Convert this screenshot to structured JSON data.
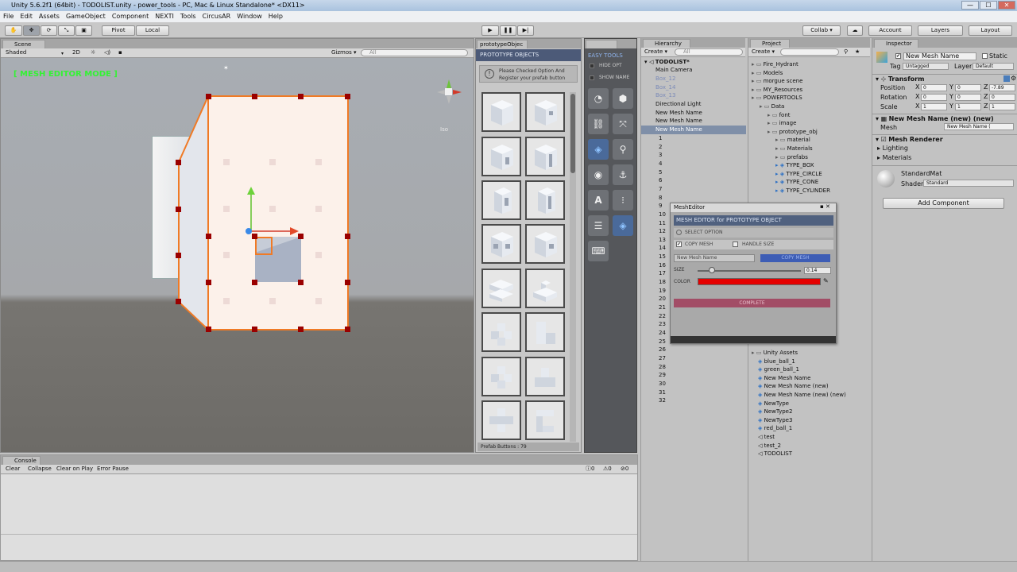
{
  "window": {
    "title": "Unity 5.6.2f1 (64bit) - TODOLIST.unity - power_tools - PC, Mac & Linux Standalone* <DX11>",
    "min": "—",
    "max": "☐",
    "close": "✕"
  },
  "menu": [
    "File",
    "Edit",
    "Assets",
    "GameObject",
    "Component",
    "NEXTI",
    "Tools",
    "CircusAR",
    "Window",
    "Help"
  ],
  "toolbar": {
    "pivot": "Pivot",
    "local": "Local",
    "collab": "Collab ▾",
    "account": "Account",
    "layers": "Layers",
    "layout": "Layout"
  },
  "scene": {
    "tab": "Scene",
    "shaded": "Shaded",
    "two_d": "2D",
    "gizmos": "Gizmos ▾",
    "search": "All",
    "mode": "[ MESH EDITOR MODE ]",
    "iso": "Iso"
  },
  "proto": {
    "tab": "prototypeObjec",
    "header": "PROTOTYPE OBJECTS",
    "info_line1": "Please Checked Option And",
    "info_line2": "Register your prefab button",
    "footer": "Prefab Buttons : 79"
  },
  "easy": {
    "header": "EASY TOOLS",
    "hide": "HIDE OPT",
    "show": "SHOW NAME"
  },
  "hierarchy": {
    "tab": "Hierarchy",
    "create": "Create ▾",
    "search": "All",
    "scene_name": "TODOLIST*",
    "items": [
      "Main Camera",
      "Box_12",
      "Box_14",
      "Box_13",
      "Directional Light",
      "New Mesh Name",
      "New Mesh Name",
      "New Mesh Name"
    ],
    "numbers": [
      "1",
      "2",
      "3",
      "4",
      "5",
      "6",
      "7",
      "8",
      "9",
      "10",
      "11",
      "12",
      "13",
      "14",
      "15",
      "16",
      "17",
      "18",
      "19",
      "20",
      "21",
      "22",
      "23",
      "24",
      "25",
      "26",
      "27",
      "28",
      "29",
      "30",
      "31",
      "32"
    ]
  },
  "project": {
    "tab": "Project",
    "create": "Create ▾",
    "tree": [
      "Fire_Hydrant",
      "Models",
      "morgue scene",
      "MY_Resources",
      "POWERTOOLS",
      "Data",
      "font",
      "image",
      "prototype_obj",
      "material",
      "Materials",
      "prefabs",
      "TYPE_BOX",
      "TYPE_CIRCLE",
      "TYPE_CONE",
      "TYPE_CYLINDER"
    ],
    "tree_bottom": [
      "Unity Assets",
      "blue_ball_1",
      "green_ball_1",
      "New Mesh Name",
      "New Mesh Name (new)",
      "New Mesh Name (new) (new)",
      "NewType",
      "NewType2",
      "NewType3",
      "red_ball_1",
      "test",
      "test_2",
      "TODOLIST"
    ]
  },
  "inspector": {
    "tab": "Inspector",
    "name": "New Mesh Name",
    "static": "Static",
    "tag_label": "Tag",
    "tag": "Untagged",
    "layer_label": "Layer",
    "layer": "Default",
    "transform": "Transform",
    "position": "Position",
    "rotation": "Rotation",
    "scale": "Scale",
    "pos": [
      "0",
      "0",
      "-7.89"
    ],
    "rot": [
      "0",
      "0",
      "0"
    ],
    "scl": [
      "1",
      "1",
      "1"
    ],
    "mesh_filter": "New Mesh Name (new) (new)",
    "mesh_label": "Mesh",
    "mesh_value": "New Mesh Name (",
    "renderer": "Mesh Renderer",
    "lighting": "Lighting",
    "materials": "Materials",
    "material_name": "StandardMat",
    "shader_label": "Shader",
    "shader": "Standard",
    "add_component": "Add Component"
  },
  "console": {
    "tab": "Console",
    "clear": "Clear",
    "collapse": "Collapse",
    "clear_on_play": "Clear on Play",
    "error_pause": "Error Pause",
    "c1": "0",
    "c2": "0",
    "c3": "0"
  },
  "mesh_editor": {
    "window_title": "MeshEditor",
    "header": "MESH EDITOR for PROTOTYPE OBJECT",
    "select_option": "SELECT OPTION",
    "copy_mesh": "COPY MESH",
    "handle_size": "HANDLE SIZE",
    "name_value": "New Mesh Name",
    "copy_button": "COPY MESH",
    "size_label": "SIZE",
    "size_value": "0.14",
    "color_label": "COLOR",
    "complete": "COMPLETE",
    "accent": "#e50000"
  }
}
